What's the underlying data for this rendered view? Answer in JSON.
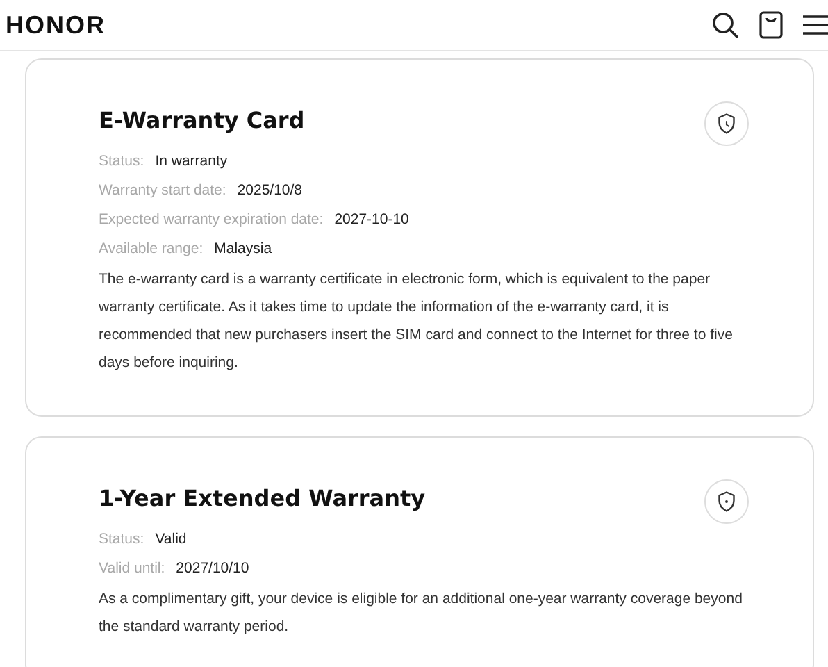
{
  "header": {
    "logo": "HONOR"
  },
  "cards": [
    {
      "title": "E-Warranty Card",
      "fields": [
        {
          "label": "Status:",
          "value": "In warranty"
        },
        {
          "label": "Warranty start date:",
          "value": "2025/10/8"
        },
        {
          "label": "Expected warranty expiration date:",
          "value": "2027-10-10"
        },
        {
          "label": "Available range:",
          "value": "Malaysia"
        }
      ],
      "description": "The e-warranty card is a warranty certificate in electronic form, which is equivalent to the paper warranty certificate. As it takes time to update the information of the e-warranty card, it is recommended that new purchasers insert the SIM card and connect to the Internet for three to five days before inquiring."
    },
    {
      "title": "1-Year Extended Warranty",
      "fields": [
        {
          "label": "Status:",
          "value": "Valid"
        },
        {
          "label": "Valid until:",
          "value": "2027/10/10"
        }
      ],
      "description": "As a complimentary gift, your device is eligible for an additional one-year warranty coverage beyond the standard warranty period."
    }
  ]
}
